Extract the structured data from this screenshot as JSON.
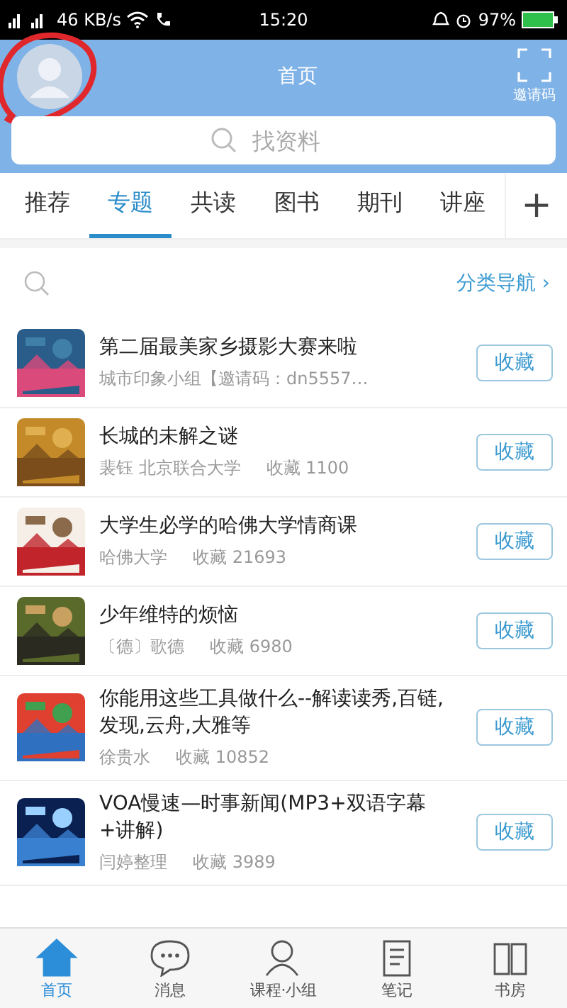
{
  "status_bar": {
    "network_speed": "46 KB/s",
    "time": "15:20",
    "battery": "97%"
  },
  "header": {
    "title": "首页",
    "scan_label": "邀请码"
  },
  "search": {
    "placeholder": "找资料"
  },
  "tabs": [
    {
      "label": "推荐",
      "selected": false
    },
    {
      "label": "专题",
      "selected": true
    },
    {
      "label": "共读",
      "selected": false
    },
    {
      "label": "图书",
      "selected": false
    },
    {
      "label": "期刊",
      "selected": false
    },
    {
      "label": "讲座",
      "selected": false
    }
  ],
  "add_tab": "+",
  "category_nav": {
    "label": "分类导航",
    "arrow": "›"
  },
  "items": [
    {
      "title": "第二届最美家乡摄影大赛来啦",
      "subtitle": "城市印象小组【邀请码：dn5557…",
      "button": "收藏",
      "kind": "picture"
    },
    {
      "title": "长城的未解之谜",
      "subtitle": "裴钰 北京联合大学",
      "saves": "收藏 1100",
      "button": "收藏",
      "kind": "picture"
    },
    {
      "title": "大学生必学的哈佛大学情商课",
      "subtitle": "哈佛大学",
      "saves": "收藏 21693",
      "button": "收藏",
      "kind": "picture"
    },
    {
      "title": "少年维特的烦恼",
      "subtitle": "〔德〕歌德",
      "saves": "收藏 6980",
      "button": "收藏",
      "kind": "picture"
    },
    {
      "title": "你能用这些工具做什么--解读读秀,百链,发现,云舟,大雅等",
      "subtitle": "徐贵水",
      "saves": "收藏 10852",
      "button": "收藏",
      "kind": "picture"
    },
    {
      "title": "VOA慢速—时事新闻(MP3+双语字幕+讲解)",
      "subtitle": "闫婷整理",
      "saves": "收藏 3989",
      "button": "收藏",
      "kind": "picture"
    }
  ],
  "bottom_nav": [
    {
      "label": "首页",
      "selected": true
    },
    {
      "label": "消息",
      "selected": false
    },
    {
      "label": "课程·小组",
      "selected": false
    },
    {
      "label": "笔记",
      "selected": false
    },
    {
      "label": "书房",
      "selected": false
    }
  ]
}
